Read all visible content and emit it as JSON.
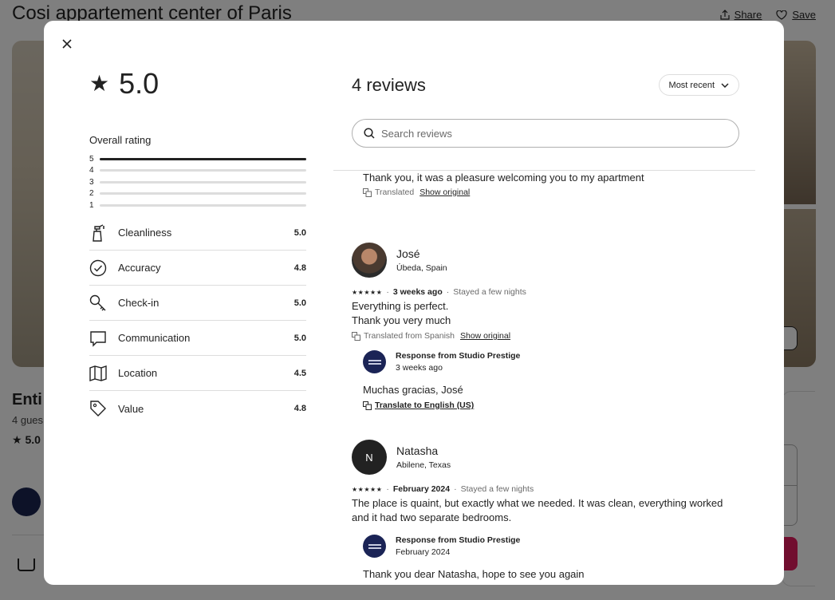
{
  "background": {
    "listing_title": "Cosi appartement center of Paris",
    "share_label": "Share",
    "save_label": "Save",
    "type_partial": "Enti",
    "guests_partial": "4 gues",
    "rating_partial": "5.0"
  },
  "modal": {
    "close_icon": "close-icon",
    "overall": {
      "score": "5.0",
      "label": "Overall rating",
      "distribution": [
        {
          "stars": "5",
          "fraction": 1.0
        },
        {
          "stars": "4",
          "fraction": 0.0
        },
        {
          "stars": "3",
          "fraction": 0.0
        },
        {
          "stars": "2",
          "fraction": 0.0
        },
        {
          "stars": "1",
          "fraction": 0.0
        }
      ]
    },
    "categories": [
      {
        "name": "Cleanliness",
        "score": "5.0",
        "icon": "spray-bottle-icon"
      },
      {
        "name": "Accuracy",
        "score": "4.8",
        "icon": "check-circle-icon"
      },
      {
        "name": "Check-in",
        "score": "5.0",
        "icon": "key-icon"
      },
      {
        "name": "Communication",
        "score": "5.0",
        "icon": "chat-bubble-icon"
      },
      {
        "name": "Location",
        "score": "4.5",
        "icon": "map-icon"
      },
      {
        "name": "Value",
        "score": "4.8",
        "icon": "tag-icon"
      }
    ],
    "reviews_header": {
      "count_label": "4 reviews",
      "sort_label": "Most recent",
      "search_placeholder": "Search reviews"
    },
    "partial_top": {
      "text": "Thank you, it was a pleasure welcoming you to my apartment",
      "translated_label": "Translated",
      "show_original": "Show original"
    },
    "reviews": [
      {
        "name": "José",
        "location": "Úbeda, Spain",
        "stars": "★★★★★",
        "when": "3 weeks ago",
        "stay": "Stayed a few nights",
        "text_lines": [
          "Everything is perfect.",
          "Thank you very much"
        ],
        "translated_label": "Translated from Spanish",
        "show_original": "Show original",
        "response": {
          "title": "Response from Studio Prestige",
          "date": "3 weeks ago",
          "text": "Muchas gracias, José",
          "translate_link": "Translate to English (US)"
        }
      },
      {
        "name": "Natasha",
        "initial": "N",
        "location": "Abilene, Texas",
        "stars": "★★★★★",
        "when": "February 2024",
        "stay": "Stayed a few nights",
        "text_lines": [
          "The place is quaint, but exactly what we needed. It was clean, everything worked",
          "and it had two separate bedrooms."
        ],
        "response": {
          "title": "Response from Studio Prestige",
          "date": "February 2024",
          "text": "Thank you dear Natasha, hope to see you again"
        }
      }
    ]
  }
}
